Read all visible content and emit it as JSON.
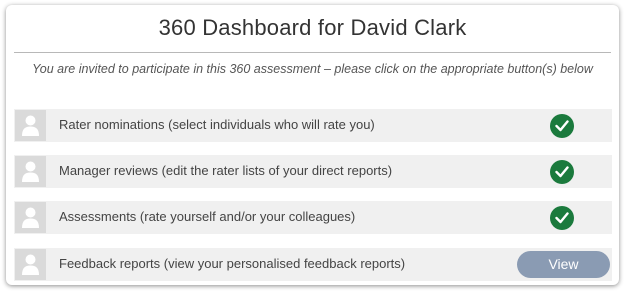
{
  "dashboard": {
    "title": "360 Dashboard for David Clark",
    "intro": "You are invited to participate in this 360 assessment – please click on the appropriate button(s) below"
  },
  "rows": [
    {
      "label": "Rater nominations (select individuals who will rate you)",
      "status": "complete",
      "icon": "user-icon"
    },
    {
      "label": "Manager reviews (edit the rater lists of your direct reports)",
      "status": "complete",
      "icon": "user-icon"
    },
    {
      "label": "Assessments (rate yourself and/or your colleagues)",
      "status": "complete",
      "icon": "user-icon"
    },
    {
      "label": "Feedback reports (view your personalised feedback reports)",
      "status": "action",
      "icon": "user-icon",
      "button_label": "View"
    }
  ],
  "colors": {
    "complete_check": "#1b7a3d",
    "view_button": "#8a9bb3"
  }
}
